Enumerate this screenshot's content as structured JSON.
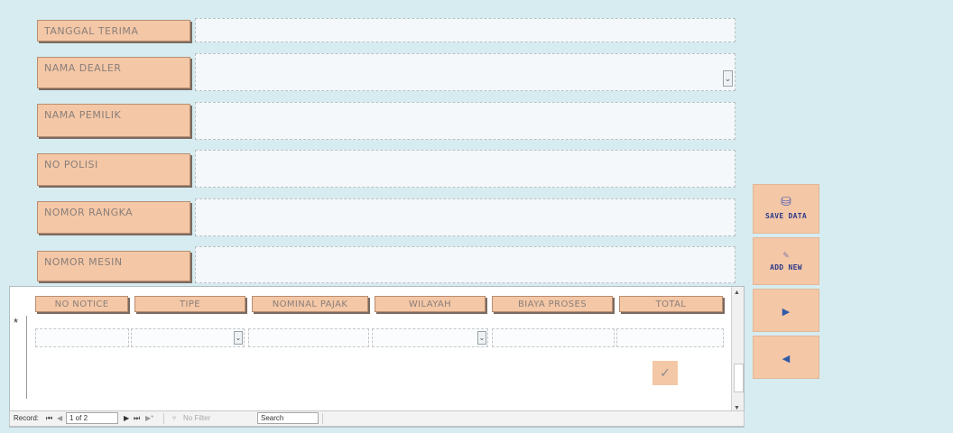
{
  "form": {
    "fields": [
      {
        "label": "TANGGAL TERIMA",
        "value": "",
        "type": "text"
      },
      {
        "label": "NAMA DEALER",
        "value": "",
        "type": "combo"
      },
      {
        "label": "NAMA PEMILIK",
        "value": "",
        "type": "text"
      },
      {
        "label": "NO POLISI",
        "value": "",
        "type": "text"
      },
      {
        "label": "NOMOR RANGKA",
        "value": "",
        "type": "text"
      },
      {
        "label": "NOMOR MESIN",
        "value": "",
        "type": "text"
      }
    ]
  },
  "side_buttons": {
    "save": {
      "label": "SAVE DATA",
      "icon": "save-icon"
    },
    "add": {
      "label": "ADD NEW",
      "icon": "add-icon"
    },
    "next": {
      "icon": "next-arrow-icon"
    },
    "prev": {
      "icon": "prev-arrow-icon"
    }
  },
  "subform": {
    "columns": [
      "NO NOTICE",
      "TIPE",
      "NOMINAL PAJAK",
      "WILAYAH",
      "BIAYA PROSES",
      "TOTAL"
    ],
    "new_row_marker": "*",
    "confirm_icon": "check-icon"
  },
  "navigation": {
    "record_label": "Record:",
    "position": "1 of 2",
    "filter_label": "No Filter",
    "search_placeholder": "Search"
  },
  "colors": {
    "background": "#d6ecf1",
    "label_fill": "#f4c7a6",
    "field_fill": "#f4f8fb"
  }
}
